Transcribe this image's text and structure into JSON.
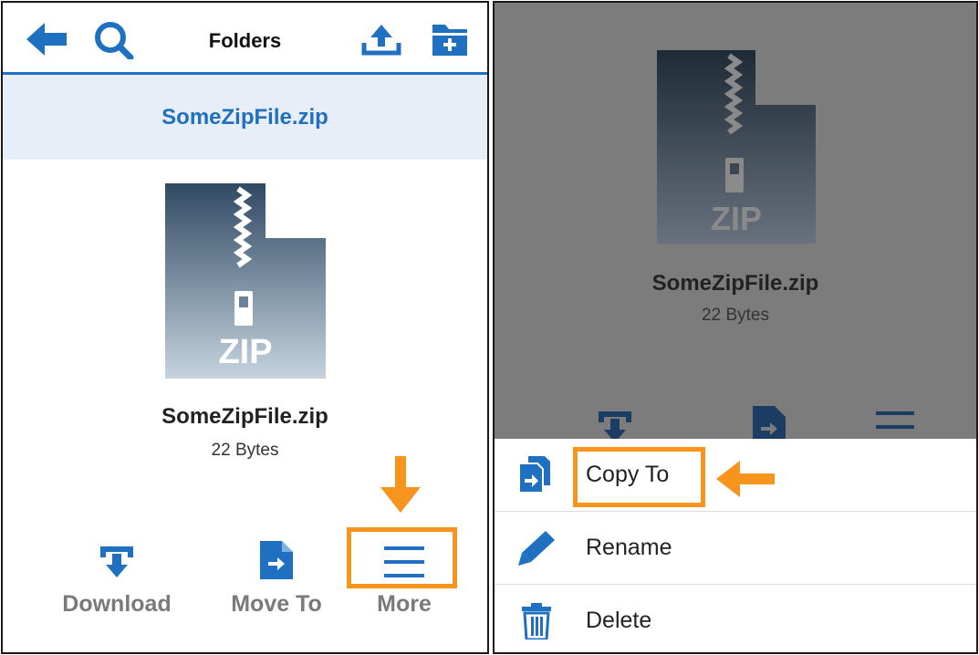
{
  "left": {
    "header": {
      "title": "Folders"
    },
    "current_file": "SomeZipFile.zip",
    "zip_label": "ZIP",
    "file": {
      "name": "SomeZipFile.zip",
      "size": "22 Bytes"
    },
    "actions": [
      {
        "label": "Download",
        "icon": "download-icon"
      },
      {
        "label": "Move To",
        "icon": "move-to-icon"
      },
      {
        "label": "More",
        "icon": "hamburger-menu-icon"
      }
    ]
  },
  "right": {
    "zip_label": "ZIP",
    "file": {
      "name": "SomeZipFile.zip",
      "size": "22 Bytes"
    },
    "menu": [
      {
        "label": "Copy To",
        "icon": "copy-to-icon"
      },
      {
        "label": "Rename",
        "icon": "pencil-icon"
      },
      {
        "label": "Delete",
        "icon": "trash-icon"
      }
    ]
  },
  "colors": {
    "accent": "#1f70c1",
    "highlight": "#f7941d",
    "overlay": "#7c7c7c"
  }
}
